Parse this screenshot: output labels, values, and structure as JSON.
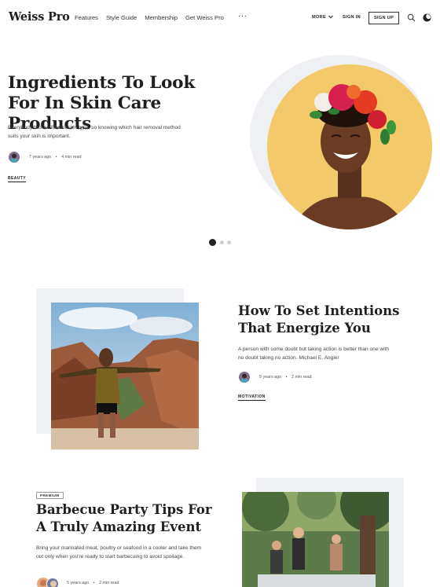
{
  "header": {
    "logo": "Weiss Pro",
    "nav": [
      "Features",
      "Style Guide",
      "Membership",
      "Get Weiss Pro"
    ],
    "more_label": "MORE",
    "signin_label": "SIGN IN",
    "signup_label": "SIGN UP",
    "overflow_glyph": "···"
  },
  "hero": {
    "title": "Ingredients To Look For In Skin Care Products",
    "excerpt": "Everybody has a different skin type, so knowing which hair removal method suits your skin is important.",
    "date": "7 years ago",
    "read_time": "4 min read",
    "tag": "BEAUTY",
    "slider": {
      "total": 3,
      "active": 1
    }
  },
  "articles": [
    {
      "title": "How To Set Intentions That Energize You",
      "excerpt": "A person with some doubt but taking action is better than one with no doubt taking no action. Michael E. Angier",
      "date": "5 years ago",
      "read_time": "2 min read",
      "tag": "MOTIVATION"
    },
    {
      "badge": "PREMIUM",
      "title": "Barbecue Party Tips For A Truly Amazing Event",
      "excerpt": "Bring your marinated meat, poultry or seafood in a cooler and take them out only when you're ready to start barbecuing to avoid spoilage.",
      "date": "5 years ago",
      "read_time": "2 min read"
    }
  ],
  "icons": [
    "search-icon",
    "moon-icon",
    "chevron-down-icon"
  ],
  "colors": {
    "text": "#1f1f1f",
    "panel": "#eef0f4",
    "accent_yellow": "#f4c96a"
  }
}
